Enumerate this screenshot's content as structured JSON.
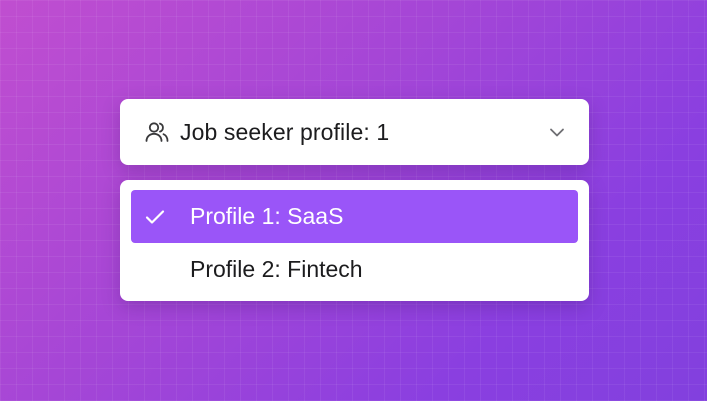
{
  "select": {
    "label": "Job seeker profile: 1",
    "icon": "users-icon",
    "chevron_icon": "chevron-down-icon"
  },
  "menu": {
    "options": [
      {
        "label": "Profile 1: SaaS",
        "selected": true
      },
      {
        "label": "Profile 2: Fintech",
        "selected": false
      }
    ]
  },
  "colors": {
    "accent": "#9a55f8",
    "background_start": "#c04ed0",
    "background_end": "#8240de"
  }
}
